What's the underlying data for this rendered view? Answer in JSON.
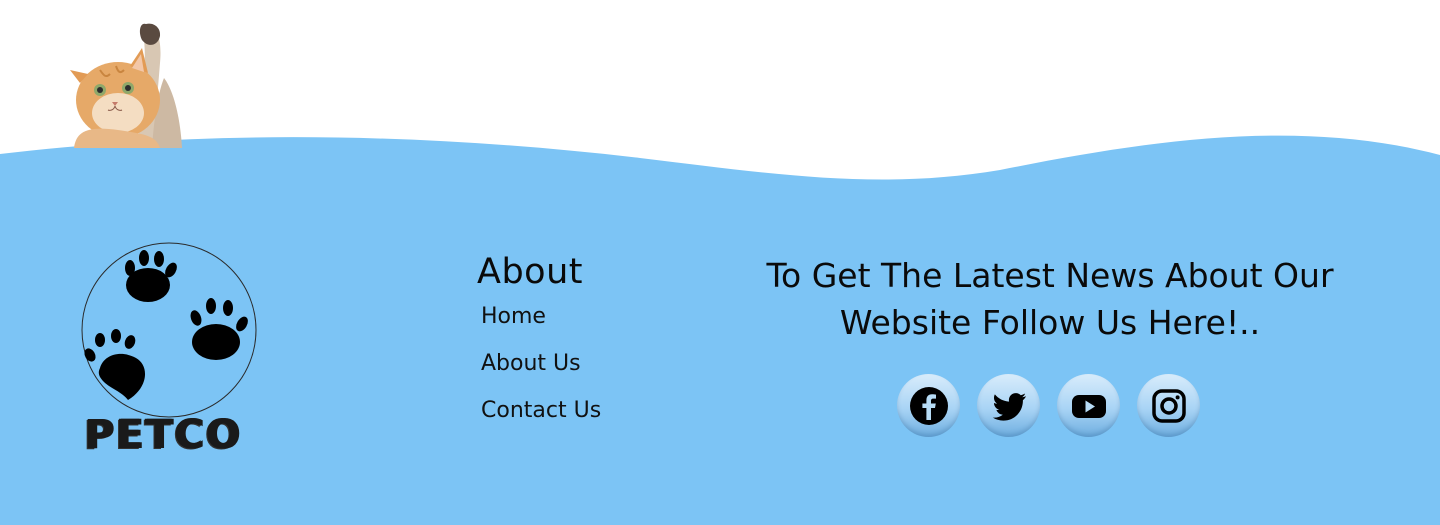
{
  "brand": {
    "name": "PETCO"
  },
  "about": {
    "heading": "About",
    "links": [
      {
        "label": "Home"
      },
      {
        "label": "About Us"
      },
      {
        "label": "Contact Us"
      }
    ]
  },
  "news": {
    "line1": "To Get The Latest News About Our",
    "line2": "Website Follow Us Here!.."
  },
  "socials": [
    {
      "icon": "facebook-icon"
    },
    {
      "icon": "twitter-icon"
    },
    {
      "icon": "youtube-icon"
    },
    {
      "icon": "instagram-icon"
    }
  ],
  "colors": {
    "footer_background": "#7cc4f5",
    "page_background": "#ffffff",
    "text": "#0a0a0a"
  }
}
